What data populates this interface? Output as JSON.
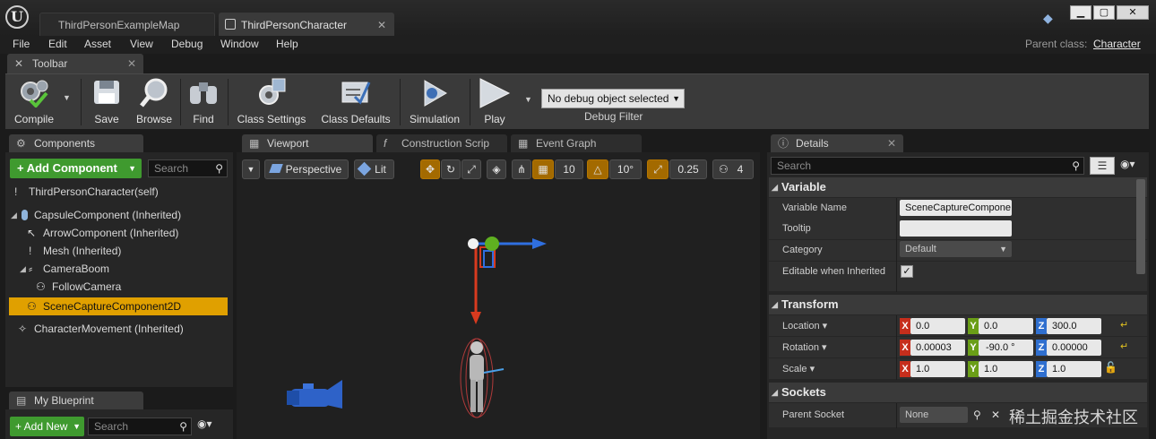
{
  "titlebar": {
    "tabs": [
      "ThirdPersonExampleMap",
      "ThirdPersonCharacter"
    ],
    "logo": "U",
    "parent_class_label": "Parent class:",
    "parent_class_value": "Character"
  },
  "menu": [
    "File",
    "Edit",
    "Asset",
    "View",
    "Debug",
    "Window",
    "Help"
  ],
  "toolbar": {
    "tab_label": "Toolbar",
    "buttons": {
      "compile": "Compile",
      "save": "Save",
      "browse": "Browse",
      "find": "Find",
      "class_settings": "Class Settings",
      "class_defaults": "Class Defaults",
      "simulation": "Simulation",
      "play": "Play"
    },
    "debug_select": "No debug object selected",
    "debug_filter_label": "Debug Filter"
  },
  "components": {
    "tab_label": "Components",
    "add_button": "+ Add Component",
    "search_placeholder": "Search",
    "items": [
      "ThirdPersonCharacter(self)",
      "CapsuleComponent (Inherited)",
      "ArrowComponent (Inherited)",
      "Mesh (Inherited)",
      "CameraBoom",
      "FollowCamera",
      "SceneCaptureComponent2D",
      "CharacterMovement (Inherited)"
    ]
  },
  "my_blueprint": {
    "tab_label": "My Blueprint",
    "add_new": "+ Add New",
    "search_placeholder": "Search"
  },
  "editor_tabs": [
    "Viewport",
    "Construction Scrip",
    "Event Graph"
  ],
  "viewport": {
    "perspective": "Perspective",
    "lit": "Lit",
    "grid_snap": "10",
    "rotation_snap": "10°",
    "scale_snap": "0.25",
    "camera_speed": "4"
  },
  "details": {
    "tab_label": "Details",
    "search_placeholder": "Search",
    "sections": {
      "variable": "Variable",
      "transform": "Transform",
      "sockets": "Sockets"
    },
    "variable": {
      "name_label": "Variable Name",
      "name_value": "SceneCaptureCompone",
      "tooltip_label": "Tooltip",
      "tooltip_value": "",
      "category_label": "Category",
      "category_value": "Default",
      "editable_label": "Editable when Inherited",
      "editable_checked": true
    },
    "transform": {
      "location_label": "Location",
      "location": {
        "x": "0.0",
        "y": "0.0",
        "z": "300.0"
      },
      "rotation_label": "Rotation",
      "rotation": {
        "x": "0.00003",
        "y": "-90.0 °",
        "z": "0.00000"
      },
      "scale_label": "Scale",
      "scale": {
        "x": "1.0",
        "y": "1.0",
        "z": "1.0"
      }
    },
    "sockets": {
      "parent_socket_label": "Parent Socket",
      "parent_socket_value": "None"
    }
  },
  "watermark": "稀土掘金技术社区",
  "colors": {
    "selection": "#e0a000",
    "add_green": "#3f9a2f",
    "axis_x": "#c62e1c",
    "axis_y": "#6a9e17",
    "axis_z": "#2f6fcf"
  }
}
